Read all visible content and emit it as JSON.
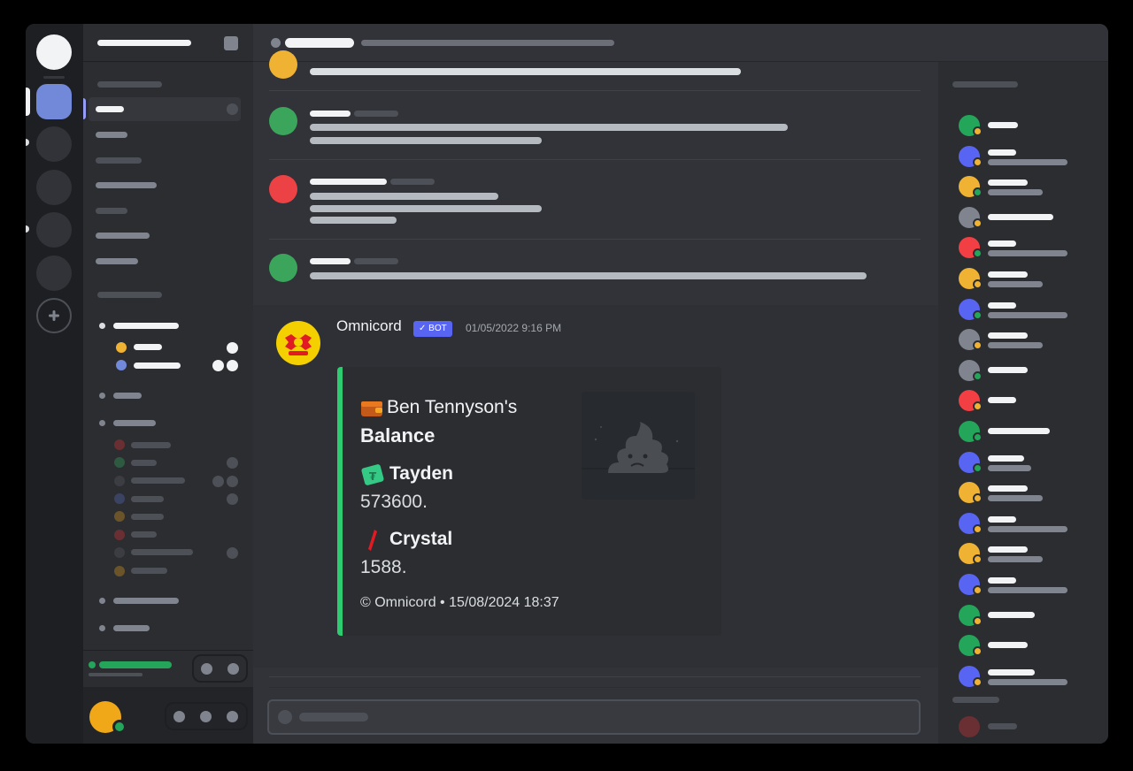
{
  "message": {
    "author": "Omnicord",
    "bot_tag": "✓ BOT",
    "timestamp": "01/05/2022 9:16 PM",
    "embed": {
      "accent_color": "#2ecc71",
      "title_line1": "Ben Tennyson's",
      "title_line2": "Balance",
      "title_icon": "wallet-icon",
      "fields": [
        {
          "icon": "tayden-currency-icon",
          "name": "Tayden",
          "value": "573600."
        },
        {
          "icon": "crystal-currency-icon",
          "name": "Crystal",
          "value": "1588."
        }
      ],
      "thumbnail_icon": "poop-emoji-icon",
      "footer": "© Omnicord • 15/08/2024 18:37"
    }
  },
  "colors": {
    "blurple": "#5865f2",
    "green": "#23a55a",
    "yellow": "#f0b232",
    "red": "#f23f43",
    "grey": "#80848e"
  }
}
